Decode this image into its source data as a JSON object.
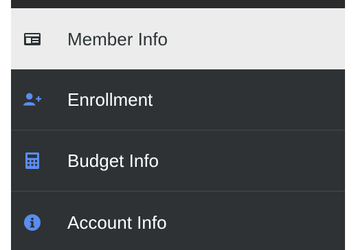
{
  "sidebar": {
    "items": [
      {
        "label": "Member Info",
        "icon": "id-card-icon",
        "active": true
      },
      {
        "label": "Enrollment",
        "icon": "user-plus-icon",
        "active": false
      },
      {
        "label": "Budget Info",
        "icon": "calculator-icon",
        "active": false
      },
      {
        "label": "Account Info",
        "icon": "info-circle-icon",
        "active": false
      }
    ]
  },
  "colors": {
    "nav_background": "#2e3235",
    "active_background": "#ececec",
    "icon_blue": "#5b8def",
    "active_text": "#2d3436"
  }
}
